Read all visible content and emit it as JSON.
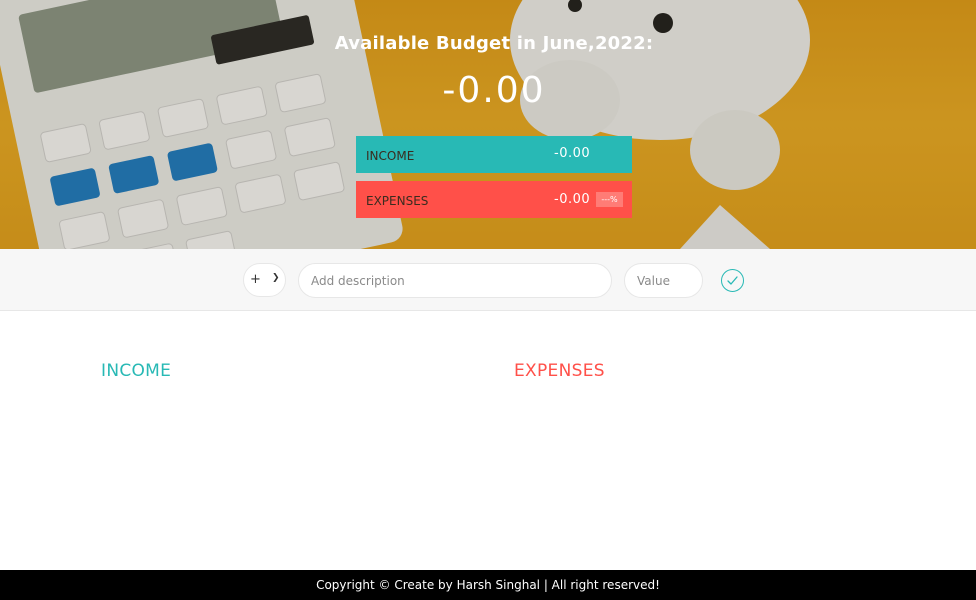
{
  "budget": {
    "title": "Available Budget in June,2022:",
    "value": "-0.00"
  },
  "summary": {
    "income": {
      "title": "INCOME",
      "value": "-0.00"
    },
    "expenses": {
      "title": "EXPENSES",
      "value": "-0.00",
      "percentage": "---%"
    }
  },
  "add_form": {
    "type_value": "+",
    "description_placeholder": "Add description",
    "value_placeholder": "Value"
  },
  "lists": {
    "income_title": "INCOME",
    "expenses_title": "EXPENSES"
  },
  "footer": {
    "text": "Copyright © Create by Harsh Singhal | All right reserved!"
  },
  "colors": {
    "income": "#28b9b5",
    "expenses": "#ff5049",
    "hero_background": "#f0b027",
    "footer_background": "#000000"
  }
}
